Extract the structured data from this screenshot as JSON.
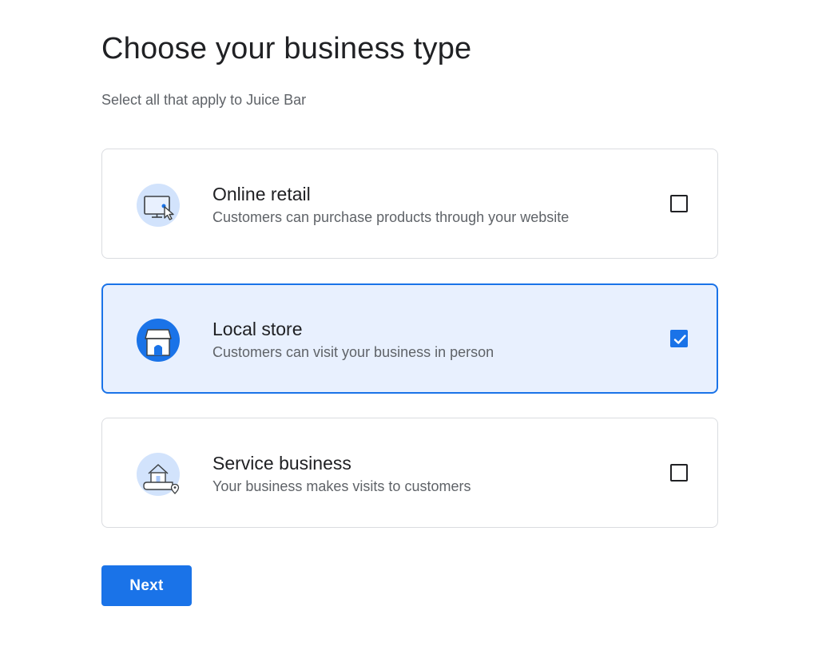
{
  "header": {
    "title": "Choose your business type",
    "subtitle": "Select all that apply to Juice Bar"
  },
  "options": [
    {
      "title": "Online retail",
      "description": "Customers can purchase products through your website",
      "icon": "monitor-cursor-icon",
      "checked": false
    },
    {
      "title": "Local store",
      "description": "Customers can visit your business in person",
      "icon": "storefront-icon",
      "checked": true
    },
    {
      "title": "Service business",
      "description": "Your business makes visits to customers",
      "icon": "house-location-icon",
      "checked": false
    }
  ],
  "actions": {
    "next_label": "Next"
  },
  "colors": {
    "accent": "#1a73e8",
    "selected_background": "#e8f0fe",
    "icon_circle_light": "#d2e3fc",
    "text_primary": "#202124",
    "text_secondary": "#5f6368",
    "border": "#dadce0"
  }
}
